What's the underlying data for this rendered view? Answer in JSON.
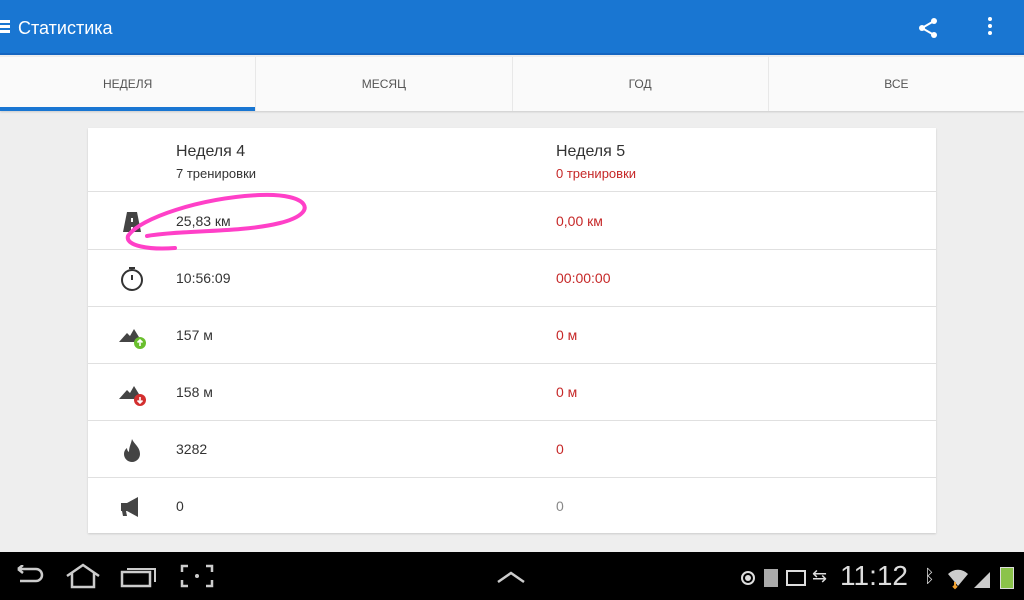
{
  "appbar": {
    "title": "Статистика",
    "icons": [
      "menu-icon",
      "share-icon",
      "more-icon"
    ]
  },
  "tabs": [
    {
      "label": "НЕДЕЛЯ",
      "active": true
    },
    {
      "label": "МЕСЯЦ"
    },
    {
      "label": "ГОД"
    },
    {
      "label": "ВСЕ"
    }
  ],
  "columns": [
    {
      "title": "Неделя 4",
      "subtitle": "7 тренировки"
    },
    {
      "title": "Неделя 5",
      "subtitle": "0 тренировки"
    }
  ],
  "rows": [
    {
      "icon": "road-icon",
      "v1": "25,83 км",
      "v2": "0,00 км"
    },
    {
      "icon": "stopwatch-icon",
      "v1": "10:56:09",
      "v2": "00:00:00"
    },
    {
      "icon": "ascent-icon",
      "v1": "157 м",
      "v2": "0 м"
    },
    {
      "icon": "descent-icon",
      "v1": "158 м",
      "v2": "0 м"
    },
    {
      "icon": "calories-icon",
      "v1": "3282",
      "v2": "0"
    },
    {
      "icon": "megaphone-icon",
      "v1": "0",
      "v2": "0"
    }
  ],
  "statusbar": {
    "time": "11:12"
  },
  "colors": {
    "primary": "#1976d2",
    "negative": "#c62828",
    "annotation": "#ff40c8"
  }
}
